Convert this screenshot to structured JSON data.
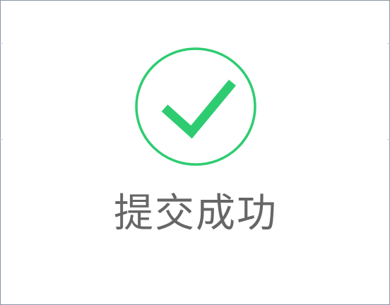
{
  "dialog": {
    "message": "提交成功"
  },
  "icon": {
    "name": "check-circle-icon",
    "color": "#2ecc71"
  }
}
